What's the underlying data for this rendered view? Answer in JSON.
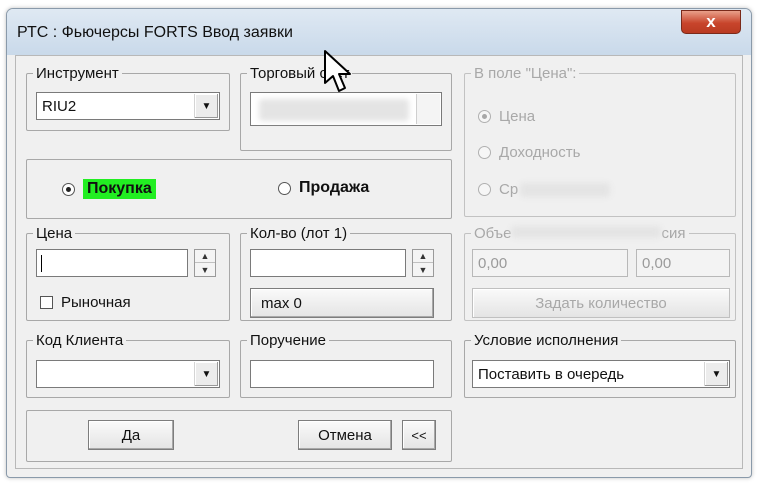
{
  "window": {
    "title": "РТС : Фьючерсы FORTS Ввод заявки",
    "close_glyph": "x"
  },
  "instrument": {
    "legend": "Инструмент",
    "value": "RIU2"
  },
  "account": {
    "legend": "Торговый счет"
  },
  "direction": {
    "buy_label": "Покупка",
    "sell_label": "Продажа",
    "selected": "buy"
  },
  "price_mode": {
    "legend": "В поле \"Цена\":",
    "options": [
      "Цена",
      "Доходность",
      "Ср"
    ],
    "selected": 0
  },
  "price": {
    "legend": "Цена",
    "value": "",
    "market_label": "Рыночная"
  },
  "quantity": {
    "legend": "Кол-во (лот 1)",
    "value": "",
    "max_label": "max 0"
  },
  "volume": {
    "legend_start": "Объе",
    "legend_end": "сия",
    "field1": "0,00",
    "field2": "0,00",
    "set_qty_label": "Задать количество"
  },
  "client_code": {
    "legend": "Код Клиента",
    "value": ""
  },
  "order_note": {
    "legend": "Поручение",
    "value": ""
  },
  "condition": {
    "legend": "Условие исполнения",
    "value": "Поставить в очередь"
  },
  "footer": {
    "ok_label": "Да",
    "cancel_label": "Отмена",
    "collapse_label": "<<"
  },
  "icons": {
    "dropdown": "▼",
    "spin_up": "▲",
    "spin_down": "▼"
  },
  "colors": {
    "buy_highlight": "#22ee22",
    "close_button": "#c8452c"
  }
}
